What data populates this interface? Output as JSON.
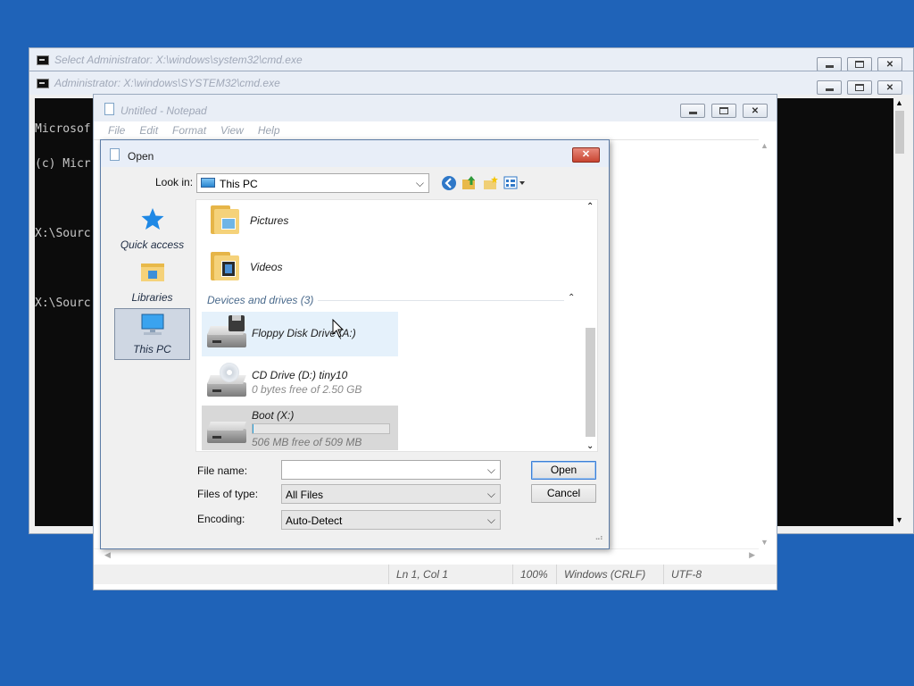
{
  "colors": {
    "desktop": "#1f63b8",
    "accent": "#3c7fd6",
    "selection": "#cfd7e3",
    "hover_row": "#e5f1fb",
    "close_button": "#c84532"
  },
  "cmd_window_1": {
    "title": "Select Administrator: X:\\windows\\system32\\cmd.exe"
  },
  "cmd_window_2": {
    "title": "Administrator: X:\\windows\\SYSTEM32\\cmd.exe",
    "console_lines": [
      "Microsof",
      "(c) Micr",
      "",
      "X:\\Sourc",
      "",
      "X:\\Sourc"
    ]
  },
  "notepad": {
    "title": "Untitled - Notepad",
    "menu": [
      "File",
      "Edit",
      "Format",
      "View",
      "Help"
    ],
    "status": {
      "position": "Ln 1, Col 1",
      "zoom": "100%",
      "line_endings": "Windows (CRLF)",
      "encoding": "UTF-8"
    }
  },
  "dialog": {
    "title": "Open",
    "look_in_label": "Look in:",
    "look_in_value": "This PC",
    "toolbar_icons": [
      "back-icon",
      "up-folder-icon",
      "new-folder-icon",
      "view-menu-icon"
    ],
    "places": [
      {
        "label": "Quick access",
        "icon": "star-icon",
        "selected": false
      },
      {
        "label": "Libraries",
        "icon": "libraries-icon",
        "selected": false
      },
      {
        "label": "This PC",
        "icon": "computer-icon",
        "selected": true
      }
    ],
    "folders": [
      {
        "label": "Pictures",
        "icon": "pictures-folder-icon"
      },
      {
        "label": "Videos",
        "icon": "videos-folder-icon"
      }
    ],
    "group_header": "Devices and drives (3)",
    "drives": [
      {
        "label": "Floppy Disk Drive (A:)",
        "detail": "",
        "icon": "floppy-drive-icon",
        "state": "hover",
        "used_fraction": null
      },
      {
        "label": "CD Drive (D:) tiny10",
        "detail": "0 bytes free of 2.50 GB",
        "icon": "cd-drive-icon",
        "state": "normal",
        "used_fraction": null
      },
      {
        "label": "Boot (X:)",
        "detail": "506 MB free of 509 MB",
        "icon": "hard-drive-icon",
        "state": "selected",
        "used_fraction": 0.006
      }
    ],
    "file_name_label": "File name:",
    "file_name_value": "",
    "file_type_label": "Files of type:",
    "file_type_value": "All Files",
    "encoding_label": "Encoding:",
    "encoding_value": "Auto-Detect",
    "open_button": "Open",
    "cancel_button": "Cancel"
  }
}
